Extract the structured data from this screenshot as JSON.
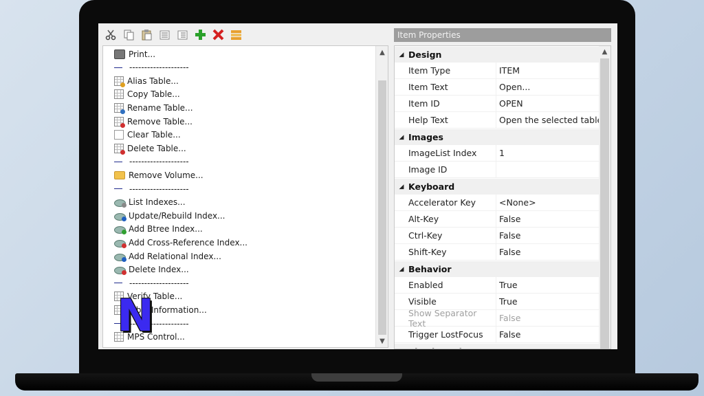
{
  "toolbar": {
    "buttons": [
      "cut-icon",
      "copy-icon",
      "paste-icon",
      "indent-left-icon",
      "indent-right-icon",
      "add-icon",
      "delete-icon",
      "properties-icon"
    ],
    "colors": {
      "add": "#2aa12a",
      "delete": "#d42020"
    }
  },
  "menu": {
    "items": [
      {
        "label": "Print...",
        "icon": "printer-icon"
      },
      {
        "label": "--------------------",
        "separator": true
      },
      {
        "label": "Alias Table...",
        "icon": "table-alias-icon"
      },
      {
        "label": "Copy Table...",
        "icon": "table-copy-icon"
      },
      {
        "label": "Rename Table...",
        "icon": "table-rename-icon"
      },
      {
        "label": "Remove Table...",
        "icon": "table-remove-icon"
      },
      {
        "label": "Clear Table...",
        "icon": "table-clear-icon"
      },
      {
        "label": "Delete Table...",
        "icon": "table-delete-icon"
      },
      {
        "label": "--------------------",
        "separator": true
      },
      {
        "label": "Remove Volume...",
        "icon": "folder-icon"
      },
      {
        "label": "--------------------",
        "separator": true
      },
      {
        "label": "List Indexes...",
        "icon": "index-list-icon"
      },
      {
        "label": "Update/Rebuild Index...",
        "icon": "index-rebuild-icon"
      },
      {
        "label": "Add Btree Index...",
        "icon": "index-add-btree-icon"
      },
      {
        "label": "Add Cross-Reference Index...",
        "icon": "index-add-xref-icon"
      },
      {
        "label": "Add Relational Index...",
        "icon": "index-add-relational-icon"
      },
      {
        "label": "Delete Index...",
        "icon": "index-delete-icon"
      },
      {
        "label": "--------------------",
        "separator": true
      },
      {
        "label": "Verify Table...",
        "icon": "table-verify-icon"
      },
      {
        "label": "Table Information...",
        "icon": "table-info-icon"
      },
      {
        "label": "--------------------",
        "separator": true
      },
      {
        "label": "MPS Control...",
        "icon": "mps-control-icon"
      }
    ]
  },
  "logo": {
    "letter": "N"
  },
  "properties": {
    "title": "Item Properties",
    "categories": [
      {
        "name": "Design",
        "rows": [
          {
            "name": "Item Type",
            "value": "ITEM"
          },
          {
            "name": "Item Text",
            "value": "Open..."
          },
          {
            "name": "Item ID",
            "value": "OPEN"
          },
          {
            "name": "Help Text",
            "value": "Open the selected table"
          }
        ]
      },
      {
        "name": "Images",
        "rows": [
          {
            "name": "ImageList Index",
            "value": "1"
          },
          {
            "name": "Image ID",
            "value": ""
          }
        ]
      },
      {
        "name": "Keyboard",
        "rows": [
          {
            "name": "Accelerator Key",
            "value": "<None>"
          },
          {
            "name": "Alt-Key",
            "value": "False"
          },
          {
            "name": "Ctrl-Key",
            "value": "False"
          },
          {
            "name": "Shift-Key",
            "value": "False"
          }
        ]
      },
      {
        "name": "Behavior",
        "rows": [
          {
            "name": "Enabled",
            "value": "True"
          },
          {
            "name": "Visible",
            "value": "True"
          },
          {
            "name": "Show Separator Text",
            "value": "False",
            "disabled": true
          },
          {
            "name": "Trigger LostFocus",
            "value": "False"
          }
        ]
      },
      {
        "name": "Check Mark",
        "rows": []
      }
    ]
  }
}
